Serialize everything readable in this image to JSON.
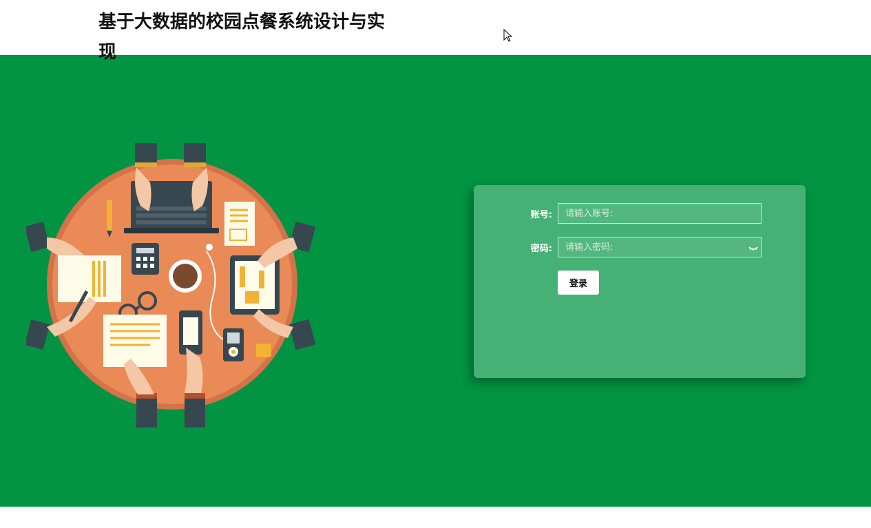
{
  "header": {
    "title": "基于大数据的校园点餐系统设计与实现"
  },
  "login": {
    "account_label": "账号:",
    "account_placeholder": "请输入账号:",
    "password_label": "密码:",
    "password_placeholder": "请输入密码:",
    "submit_label": "登录"
  },
  "colors": {
    "background": "#029442",
    "table": "#ea8a57",
    "card": "rgba(255,255,255,0.27)"
  },
  "icons": {
    "password_toggle": "eye-closed-icon"
  }
}
